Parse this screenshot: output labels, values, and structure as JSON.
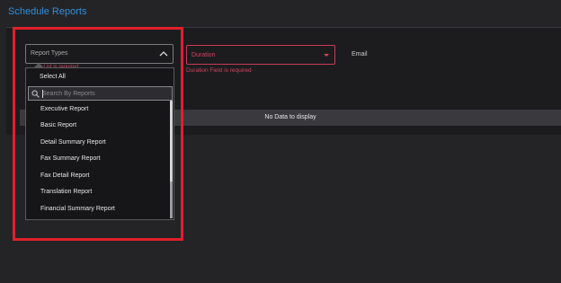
{
  "page": {
    "title": "Schedule Reports"
  },
  "filters": {
    "report_types": {
      "label": "Report Types",
      "error": "t List is required"
    },
    "duration": {
      "label": "Duration",
      "error": "Duration Field is required"
    },
    "email": {
      "label": "Email"
    }
  },
  "dropdown": {
    "select_all": "Select All",
    "search_placeholder": "Search By Reports",
    "options": [
      "Executive Report",
      "Basic Report",
      "Detail Summary Report",
      "Fax Summary Report",
      "Fax Detail Report",
      "Translation Report",
      "Financial Summary Report"
    ]
  },
  "results": {
    "empty_text": "No Data to display"
  },
  "colors": {
    "accent": "#2f8fd8",
    "error": "#d1445e",
    "highlight": "#e0202a",
    "background": "#242427"
  },
  "icons": {
    "search": "search-icon",
    "chevron": "chevron-up-icon",
    "caret": "caret-down-icon"
  }
}
